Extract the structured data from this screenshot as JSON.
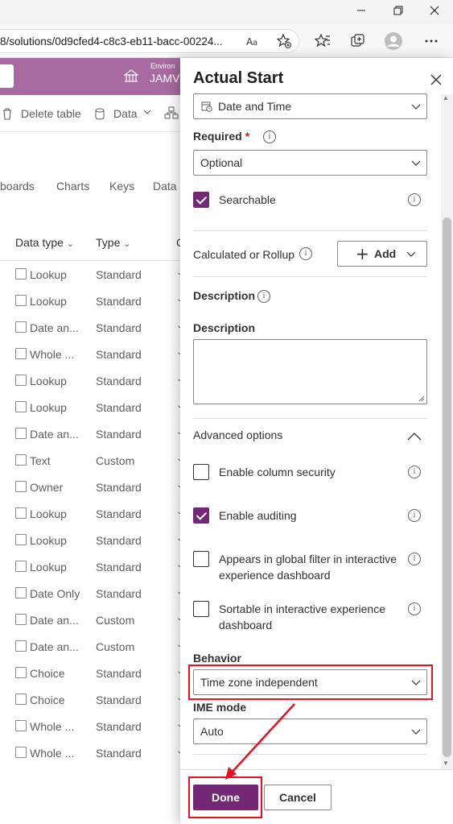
{
  "browser": {
    "url": "8/solutions/0d9cfed4-c8c3-eb11-bacc-00224...",
    "read_aloud_icon": "read-aloud-icon",
    "window_controls": [
      "minimize-icon",
      "restore-icon",
      "close-icon"
    ]
  },
  "app": {
    "environment_label": "Environ",
    "environment_name": "JAMV",
    "commands": [
      "Delete table",
      "Data"
    ],
    "tabs": [
      "boards",
      "Charts",
      "Keys",
      "Data"
    ],
    "columns": [
      "Data type",
      "Type",
      "C"
    ],
    "rows": [
      {
        "data_type": "Lookup",
        "type": "Standard"
      },
      {
        "data_type": "Lookup",
        "type": "Standard"
      },
      {
        "data_type": "Date an...",
        "type": "Standard"
      },
      {
        "data_type": "Whole ...",
        "type": "Standard"
      },
      {
        "data_type": "Lookup",
        "type": "Standard"
      },
      {
        "data_type": "Lookup",
        "type": "Standard"
      },
      {
        "data_type": "Date an...",
        "type": "Standard"
      },
      {
        "data_type": "Text",
        "type": "Custom"
      },
      {
        "data_type": "Owner",
        "type": "Standard"
      },
      {
        "data_type": "Lookup",
        "type": "Standard"
      },
      {
        "data_type": "Lookup",
        "type": "Standard"
      },
      {
        "data_type": "Lookup",
        "type": "Standard"
      },
      {
        "data_type": "Date Only",
        "type": "Standard"
      },
      {
        "data_type": "Date an...",
        "type": "Custom"
      },
      {
        "data_type": "Date an...",
        "type": "Custom"
      },
      {
        "data_type": "Choice",
        "type": "Standard"
      },
      {
        "data_type": "Choice",
        "type": "Standard"
      },
      {
        "data_type": "Whole ...",
        "type": "Standard"
      },
      {
        "data_type": "Whole ...",
        "type": "Standard"
      }
    ]
  },
  "panel": {
    "title": "Actual Start",
    "data_type_value": "Date and Time",
    "required_label": "Required",
    "required_mark": "*",
    "required_value": "Optional",
    "searchable_label": "Searchable",
    "searchable_checked": true,
    "calculated_label": "Calculated or Rollup",
    "add_label": "Add",
    "description_heading": "Description",
    "description_label": "Description",
    "description_value": "",
    "advanced_label": "Advanced options",
    "column_security_label": "Enable column security",
    "column_security_checked": false,
    "auditing_label": "Enable auditing",
    "auditing_checked": true,
    "global_filter_label_1": "Appears in global filter in interactive",
    "global_filter_label_2": "experience dashboard",
    "global_filter_checked": false,
    "sortable_label_1": "Sortable in interactive experience",
    "sortable_label_2": "dashboard",
    "sortable_checked": false,
    "behavior_label": "Behavior",
    "behavior_value": "Time zone independent",
    "ime_label": "IME mode",
    "ime_value": "Auto",
    "done_label": "Done",
    "cancel_label": "Cancel"
  },
  "colors": {
    "accent": "#742774",
    "header": "#a86aa0",
    "highlight": "#e81123"
  }
}
